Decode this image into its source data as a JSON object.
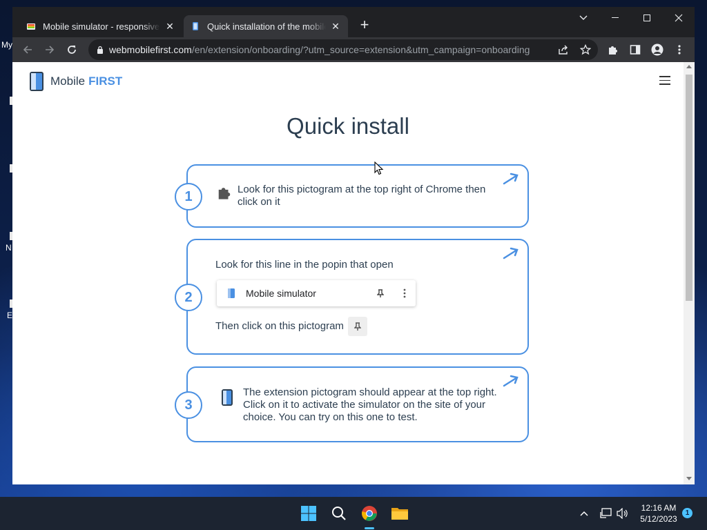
{
  "desktop": {
    "labels": [
      "My",
      "N",
      "E"
    ]
  },
  "browser": {
    "tabs": [
      {
        "title": "Mobile simulator - responsive testing",
        "active": false
      },
      {
        "title": "Quick installation of the mobile simulator",
        "active": true
      }
    ],
    "new_tab_symbol": "+",
    "url_host": "webmobilefirst.com",
    "url_path": "/en/extension/onboarding/?utm_source=extension&utm_campaign=onboarding"
  },
  "site": {
    "brand_prefix": "Mobile",
    "brand_suffix": "FIRST",
    "heading": "Quick install",
    "steps": [
      {
        "number": "1",
        "text": "Look for this pictogram at the top right of Chrome then click on it"
      },
      {
        "number": "2",
        "intro": "Look for this line in the popin that open",
        "popin_label": "Mobile simulator",
        "outro": "Then click on this pictogram"
      },
      {
        "number": "3",
        "text": "The extension pictogram should appear at the top right. Click on it to activate the simulator on the site of your choice. You can try on this one to test."
      }
    ]
  },
  "taskbar": {
    "time": "12:16 AM",
    "date": "5/12/2023",
    "notification_count": "1"
  },
  "colors": {
    "accent": "#4a90e2",
    "heading": "#2c3e50",
    "chrome_dark": "#202124",
    "chrome_toolbar": "#35363a"
  }
}
